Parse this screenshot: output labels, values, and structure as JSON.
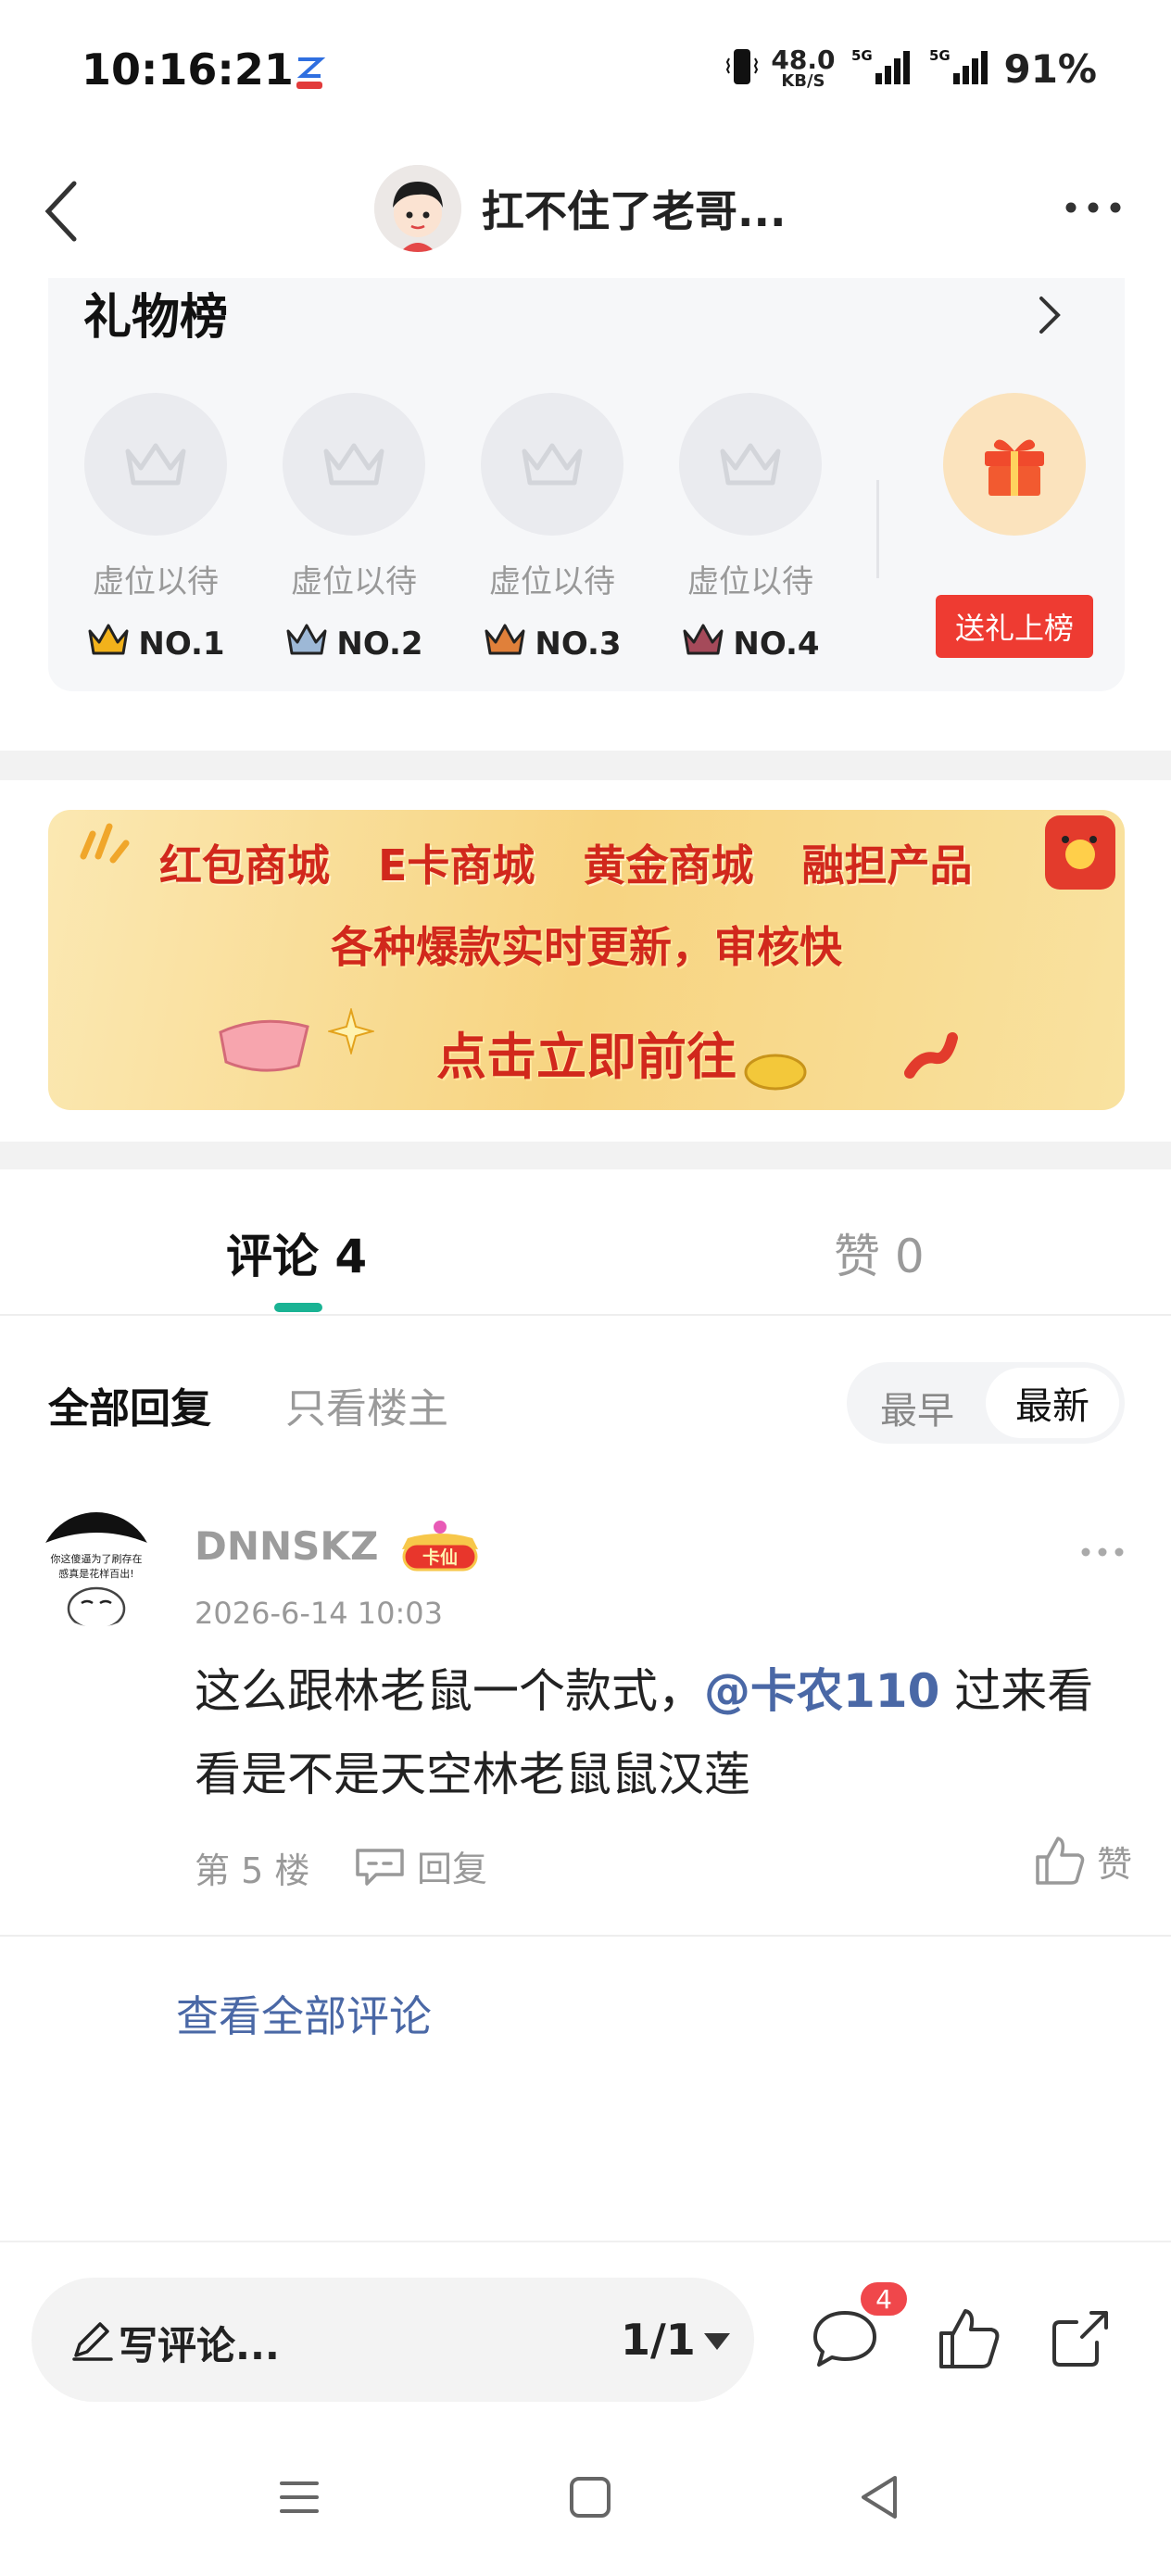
{
  "status_bar": {
    "time": "10:16:21",
    "net_speed_value": "48.0",
    "net_speed_unit": "KB/S",
    "battery": "91%"
  },
  "header": {
    "title": "扛不住了老哥..."
  },
  "gift_board": {
    "title": "礼物榜",
    "slots": [
      {
        "label": "虚位以待",
        "rank": "NO.1",
        "crown_color": "#f2b21b"
      },
      {
        "label": "虚位以待",
        "rank": "NO.2",
        "crown_color": "#9db8d6"
      },
      {
        "label": "虚位以待",
        "rank": "NO.3",
        "crown_color": "#e0803a"
      },
      {
        "label": "虚位以待",
        "rank": "NO.4",
        "crown_color": "#a54a5a"
      }
    ],
    "send_button": "送礼上榜"
  },
  "banner": {
    "items": [
      "红包商城",
      "E卡商城",
      "黄金商城",
      "融担产品"
    ],
    "line2": "各种爆款实时更新，审核快",
    "cta": "点击立即前往"
  },
  "tabs": {
    "comments": "评论 4",
    "likes": "赞 0"
  },
  "filter": {
    "all_replies": "全部回复",
    "op_only": "只看楼主",
    "sort_earliest": "最早",
    "sort_latest": "最新"
  },
  "comment": {
    "avatar_text_1": "你这傻逼为了刷存在",
    "avatar_text_2": "感真是花样百出!",
    "username": "DNNSKZ",
    "badge": "卡仙",
    "time": "2026-6-14 10:03",
    "text_before": "这么跟林老鼠一个款式，",
    "mention": "@卡农110",
    "text_after": " 过来看看是不是天空林老鼠鼠汉莲",
    "floor": "第 5 楼",
    "reply_label": "回复",
    "like_label": "赞"
  },
  "view_all": "查看全部评论",
  "bottom_bar": {
    "write_placeholder": "写评论...",
    "page_indicator": "1/1",
    "comment_badge": "4"
  },
  "colors": {
    "accent_green": "#1ab394",
    "link_blue": "#4a68a6",
    "gift_red": "#ee3b32",
    "badge_red": "#f0474b"
  }
}
